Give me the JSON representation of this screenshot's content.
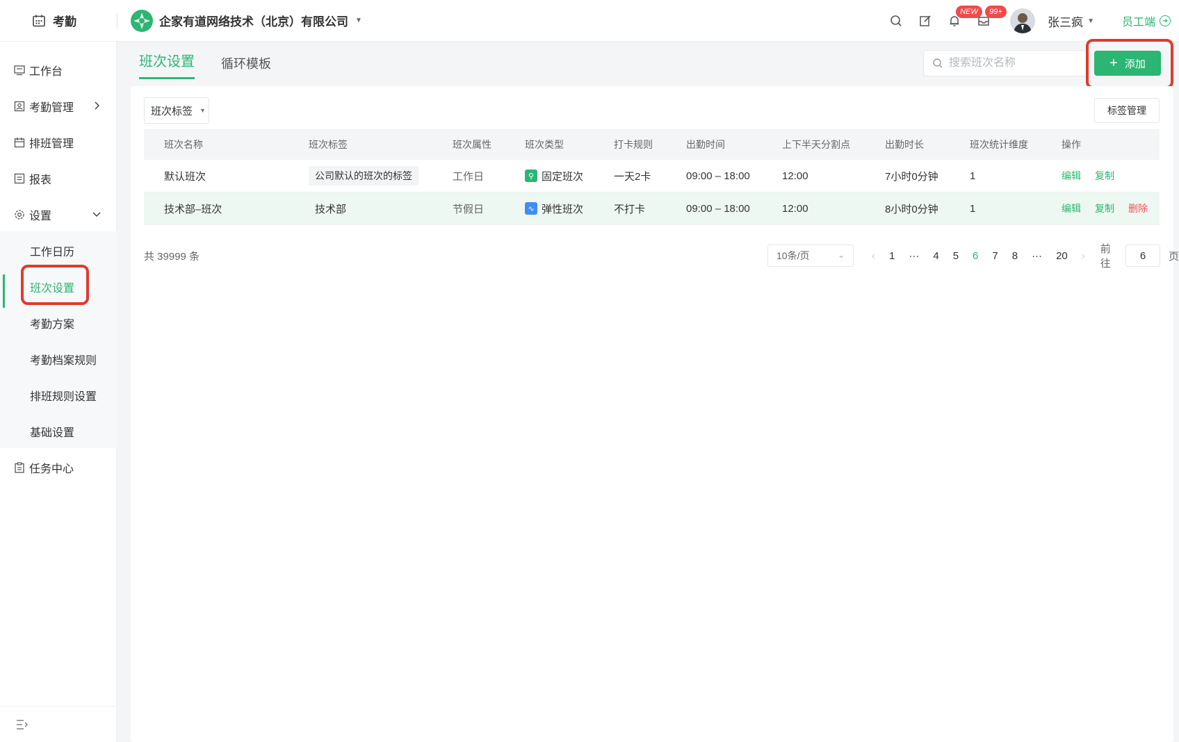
{
  "topbar": {
    "app_title": "考勤",
    "company": "企家有道网络技术（北京）有限公司",
    "badges": {
      "notifications": "NEW",
      "messages": "99+"
    },
    "user_name": "张三疯",
    "employee_link": "员工端"
  },
  "sidebar": {
    "items": [
      {
        "label": "工作台",
        "icon": "monitor-icon"
      },
      {
        "label": "考勤管理",
        "icon": "attendance-icon"
      },
      {
        "label": "排班管理",
        "icon": "schedule-icon"
      },
      {
        "label": "报表",
        "icon": "report-icon"
      },
      {
        "label": "设置",
        "icon": "gear-icon"
      },
      {
        "label": "任务中心",
        "icon": "task-icon"
      }
    ],
    "settings_children": [
      "工作日历",
      "班次设置",
      "考勤方案",
      "考勤档案规则",
      "排班规则设置",
      "基础设置"
    ],
    "active_child": "班次设置"
  },
  "tabs": [
    "班次设置",
    "循环模板"
  ],
  "search": {
    "placeholder": "搜索班次名称"
  },
  "add_button": "添加",
  "filter": {
    "tag_select": "班次标签"
  },
  "tag_management": "标签管理",
  "table": {
    "columns": [
      "班次名称",
      "班次标签",
      "班次属性",
      "班次类型",
      "打卡规则",
      "出勤时间",
      "上下半天分割点",
      "出勤时长",
      "班次统计维度",
      "操作"
    ],
    "rows": [
      {
        "name": "默认班次",
        "tag": "公司默认的班次的标签",
        "attr": "工作日",
        "type": "固定班次",
        "type_color": "#2bb673",
        "rule": "一天2卡",
        "time": "09:00 – 18:00",
        "split": "12:00",
        "duration": "7小时0分钟",
        "dimension": "1",
        "ops": [
          "编辑",
          "复制"
        ]
      },
      {
        "name": "技术部–班次",
        "tag": "技术部",
        "attr": "节假日",
        "type": "弹性班次",
        "type_color": "#3d8ef0",
        "rule": "不打卡",
        "time": "09:00 – 18:00",
        "split": "12:00",
        "duration": "8小时0分钟",
        "dimension": "1",
        "ops": [
          "编辑",
          "复制",
          "删除"
        ]
      }
    ]
  },
  "pagination": {
    "total": "共 39999 条",
    "page_size": "10条/页",
    "pages": [
      "1",
      "···",
      "4",
      "5",
      "6",
      "7",
      "8",
      "···",
      "20"
    ],
    "current": "6",
    "jump_label": "前往",
    "jump_value": "6",
    "suffix": "页"
  },
  "colors": {
    "accent": "#2bb673",
    "danger": "#f05353",
    "highlight": "#e03a2f"
  }
}
